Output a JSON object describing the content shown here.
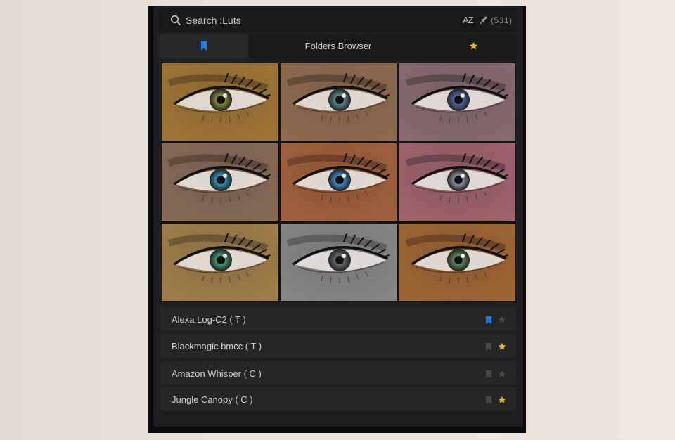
{
  "search": {
    "placeholder": "Search :Luts",
    "sort_label": "AZ",
    "count": "(531)"
  },
  "tabs": {
    "folders_label": "Folders Browser"
  },
  "icons": {
    "search": "search-icon",
    "sort": "sort-az-icon",
    "pin": "pin-icon",
    "bookmark": "bookmark-icon",
    "star": "star-icon"
  },
  "colors": {
    "accent_blue": "#1e7cf0",
    "star_gold": "#e8b62b",
    "inactive_icon": "#4a4a4d"
  },
  "thumbnails": [
    {
      "tint": "#b4863f",
      "iris": "#8a8a32"
    },
    {
      "tint": "#a27a5b",
      "iris": "#5b8a93"
    },
    {
      "tint": "#9b7a80",
      "iris": "#5766a6"
    },
    {
      "tint": "#9a7a64",
      "iris": "#2e93b8"
    },
    {
      "tint": "#b86e45",
      "iris": "#3f86c2"
    },
    {
      "tint": "#b5727e",
      "iris": "#8b8f9a"
    },
    {
      "tint": "#b78f56",
      "iris": "#3f9a72"
    },
    {
      "tint": "#9a9a9a",
      "iris": "#6a6a6a"
    },
    {
      "tint": "#b5743c",
      "iris": "#5a8a5a"
    }
  ],
  "list": [
    {
      "label": "Alexa Log-C2 ( T )",
      "bookmarked": true,
      "starred": false
    },
    {
      "label": "Blackmagic bmcc ( T )",
      "bookmarked": false,
      "starred": true
    },
    {
      "label": "Amazon Whisper ( C )",
      "bookmarked": false,
      "starred": false
    },
    {
      "label": "Jungle Canopy ( C )",
      "bookmarked": false,
      "starred": true
    }
  ]
}
